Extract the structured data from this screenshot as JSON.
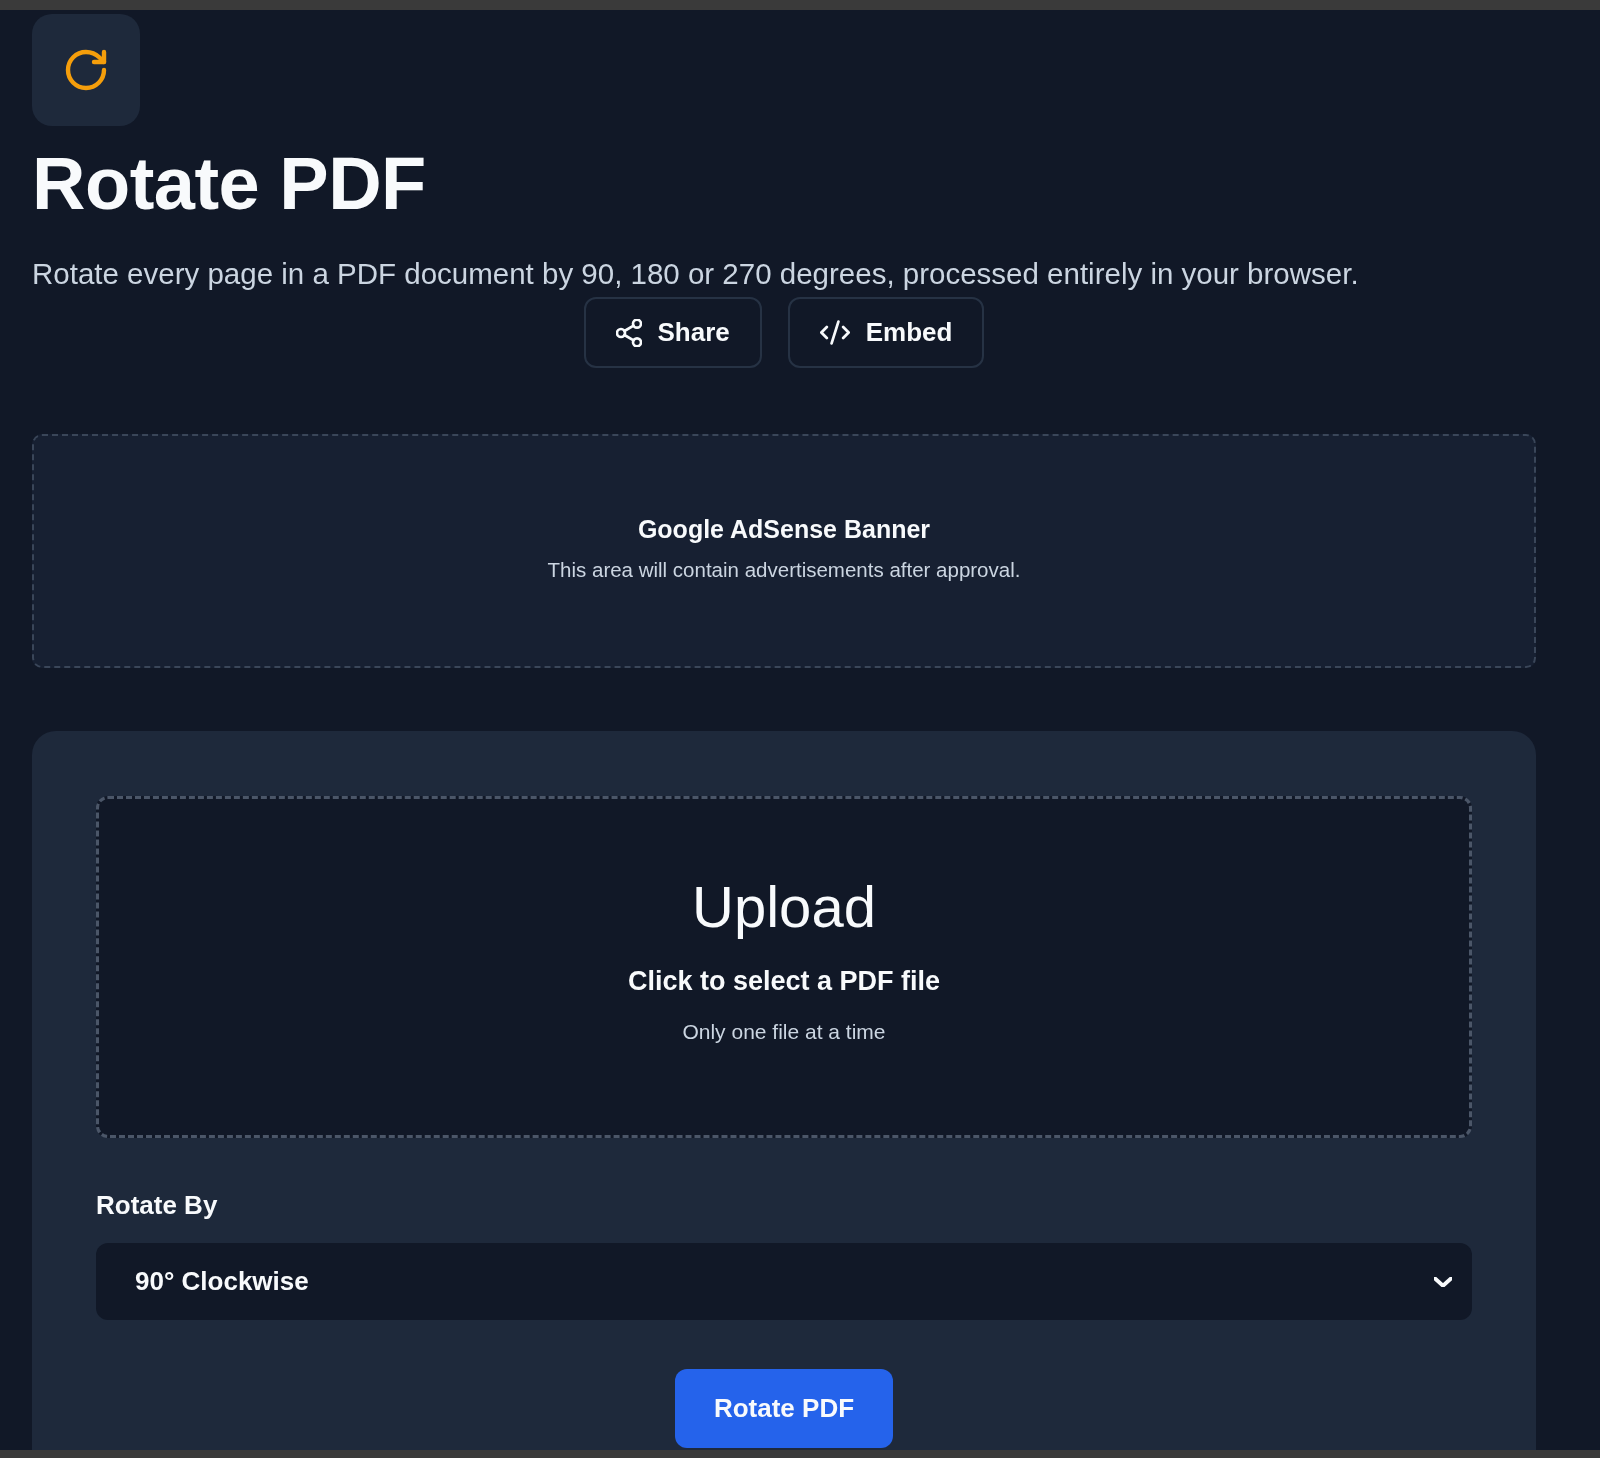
{
  "page": {
    "title": "Rotate PDF",
    "description": "Rotate every page in a PDF document by 90, 180 or 270 degrees, processed entirely in your browser."
  },
  "actions": [
    {
      "kind": "share",
      "label": "Share"
    },
    {
      "kind": "embed",
      "label": "Embed"
    }
  ],
  "ad_banner": {
    "title": "Google AdSense Banner",
    "text": "This area will contain advertisements after approval."
  },
  "upload": {
    "title": "Upload",
    "instruction": "Click to select a PDF file",
    "hint": "Only one file at a time"
  },
  "rotate_by": {
    "label": "Rotate By",
    "value": "90° Clockwise"
  },
  "submit_button": "Rotate PDF"
}
